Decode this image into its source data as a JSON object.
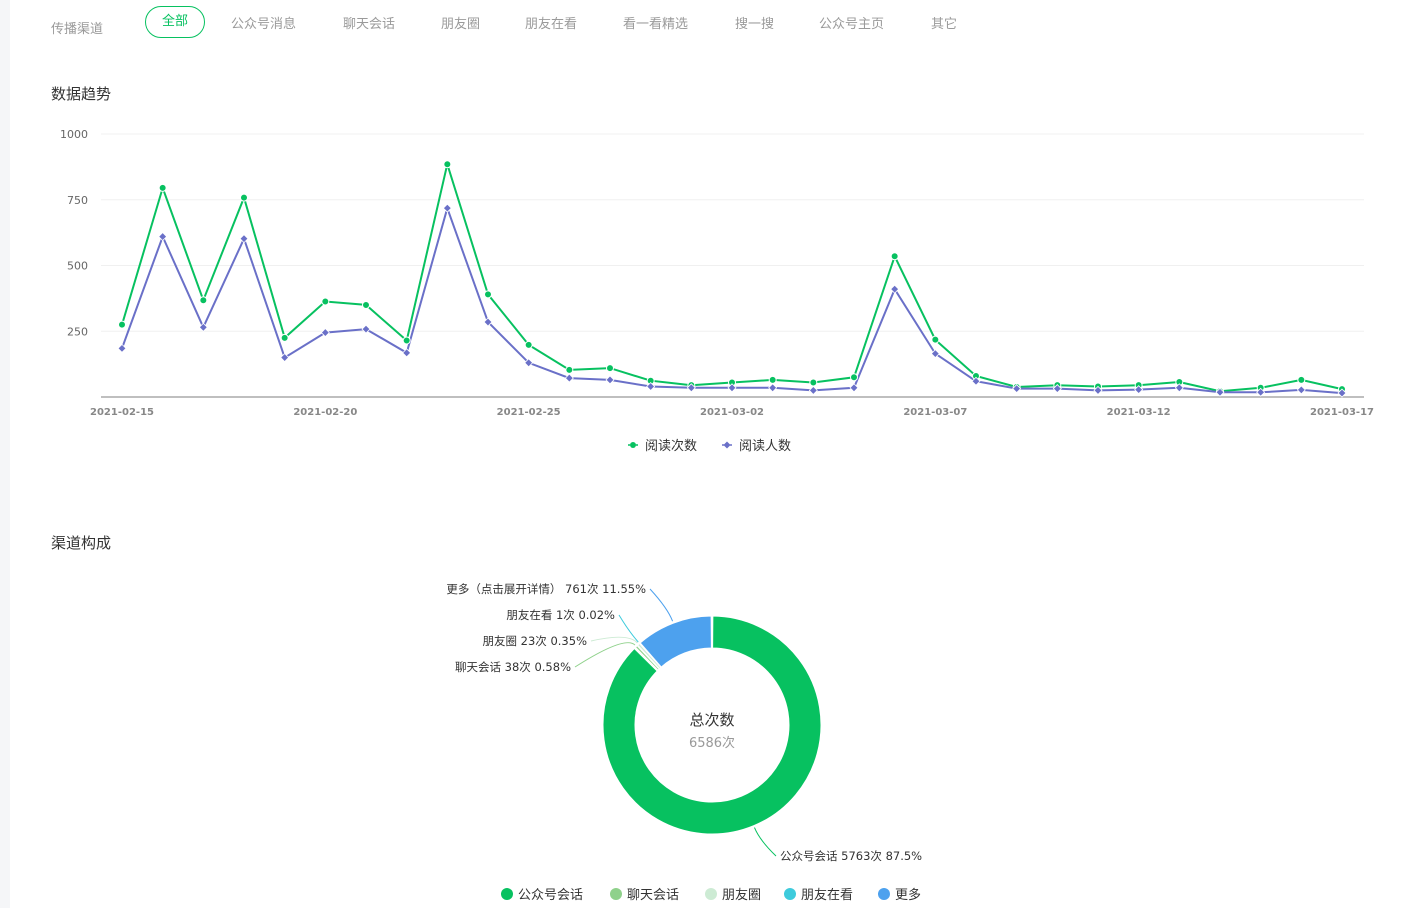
{
  "filter": {
    "label": "传播渠道",
    "tabs": [
      {
        "label": "全部",
        "active": true
      },
      {
        "label": "公众号消息",
        "active": false
      },
      {
        "label": "聊天会话",
        "active": false
      },
      {
        "label": "朋友圈",
        "active": false
      },
      {
        "label": "朋友在看",
        "active": false
      },
      {
        "label": "看一看精选",
        "active": false
      },
      {
        "label": "搜一搜",
        "active": false
      },
      {
        "label": "公众号主页",
        "active": false
      },
      {
        "label": "其它",
        "active": false
      }
    ]
  },
  "sections": {
    "trend_title": "数据趋势",
    "channel_title": "渠道构成"
  },
  "colors": {
    "green": "#07c160",
    "purple": "#6a70c8",
    "grid": "#f0f0f0",
    "axis": "#aaaaaa"
  },
  "chart_data": [
    {
      "type": "line",
      "title": "",
      "x": [
        "2021-02-15",
        "2021-02-16",
        "2021-02-17",
        "2021-02-18",
        "2021-02-19",
        "2021-02-20",
        "2021-02-21",
        "2021-02-22",
        "2021-02-23",
        "2021-02-24",
        "2021-02-25",
        "2021-02-26",
        "2021-02-27",
        "2021-02-28",
        "2021-03-01",
        "2021-03-02",
        "2021-03-03",
        "2021-03-04",
        "2021-03-05",
        "2021-03-06",
        "2021-03-07",
        "2021-03-08",
        "2021-03-09",
        "2021-03-10",
        "2021-03-11",
        "2021-03-12",
        "2021-03-13",
        "2021-03-14",
        "2021-03-15",
        "2021-03-16",
        "2021-03-17"
      ],
      "x_tick_labels": [
        "2021-02-15",
        "2021-02-20",
        "2021-02-25",
        "2021-03-02",
        "2021-03-07",
        "2021-03-12",
        "2021-03-17"
      ],
      "y_ticks": [
        250,
        500,
        750,
        1000
      ],
      "ylim": [
        0,
        1000
      ],
      "grid": true,
      "legend_position": "bottom-center",
      "series": [
        {
          "name": "阅读次数",
          "color": "#07c160",
          "marker": "circle",
          "values": [
            275,
            795,
            368,
            758,
            225,
            363,
            350,
            215,
            885,
            390,
            198,
            103,
            110,
            62,
            45,
            55,
            65,
            55,
            75,
            535,
            218,
            80,
            38,
            45,
            40,
            45,
            57,
            22,
            35,
            65,
            30
          ]
        },
        {
          "name": "阅读人数",
          "color": "#6a70c8",
          "marker": "diamond",
          "values": [
            185,
            610,
            265,
            602,
            150,
            245,
            258,
            168,
            718,
            285,
            130,
            72,
            65,
            40,
            35,
            35,
            35,
            25,
            35,
            410,
            165,
            60,
            32,
            32,
            25,
            28,
            35,
            18,
            18,
            27,
            15
          ]
        }
      ]
    },
    {
      "type": "pie",
      "center_title": "总次数",
      "center_value": "6586次",
      "legend_position": "bottom-center",
      "slices": [
        {
          "name": "公众号会话",
          "value": 5763,
          "label": "公众号会话 5763次 87.5%",
          "color": "#07c160"
        },
        {
          "name": "聊天会话",
          "value": 38,
          "label": "聊天会话 38次 0.58%",
          "color": "#8fd18b"
        },
        {
          "name": "朋友圈",
          "value": 23,
          "label": "朋友圈 23次 0.35%",
          "color": "#cdebd4"
        },
        {
          "name": "朋友在看",
          "value": 1,
          "label": "朋友在看 1次 0.02%",
          "color": "#3ecbdc"
        },
        {
          "name": "更多",
          "value": 761,
          "label": "更多（点击展开详情） 761次 11.55%",
          "color": "#4da1ee"
        }
      ]
    }
  ]
}
